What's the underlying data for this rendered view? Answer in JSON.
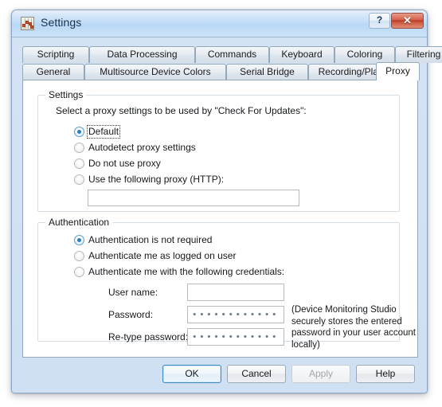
{
  "window": {
    "title": "Settings",
    "app_icon": "chart-grid-icon",
    "help_button": "?",
    "close_button": "✕"
  },
  "tabs": {
    "row1": [
      {
        "label": "Scripting",
        "active": false
      },
      {
        "label": "Data Processing",
        "active": false
      },
      {
        "label": "Commands",
        "active": false
      },
      {
        "label": "Keyboard",
        "active": false
      },
      {
        "label": "Coloring",
        "active": false
      },
      {
        "label": "Filtering",
        "active": false
      }
    ],
    "row2": [
      {
        "label": "General",
        "active": false
      },
      {
        "label": "Multisource Device Colors",
        "active": false
      },
      {
        "label": "Serial Bridge",
        "active": false
      },
      {
        "label": "Recording/Playback",
        "active": false
      },
      {
        "label": "Proxy",
        "active": true
      }
    ]
  },
  "settings_group": {
    "legend": "Settings",
    "description": "Select a proxy settings to be used by \"Check For Updates\":",
    "options": [
      {
        "label": "Default",
        "checked": true,
        "focused": true
      },
      {
        "label": "Autodetect proxy settings",
        "checked": false,
        "focused": false
      },
      {
        "label": "Do not use proxy",
        "checked": false,
        "focused": false
      },
      {
        "label": "Use the following proxy (HTTP):",
        "checked": false,
        "focused": false
      }
    ],
    "proxy_input": {
      "value": "",
      "placeholder": ""
    }
  },
  "authentication_group": {
    "legend": "Authentication",
    "options": [
      {
        "label": "Authentication is not required",
        "checked": true
      },
      {
        "label": "Authenticate me as logged on user",
        "checked": false
      },
      {
        "label": "Authenticate me with the following credentials:",
        "checked": false
      }
    ],
    "fields": {
      "username_label": "User name:",
      "username_value": "",
      "password_label": "Password:",
      "password_masked": "••••••••••••",
      "retype_label": "Re-type password:",
      "retype_masked": "••••••••••••"
    },
    "note": "(Device Monitoring Studio securely stores the entered password in your user account locally)"
  },
  "footer": {
    "ok": "OK",
    "cancel": "Cancel",
    "apply": "Apply",
    "help": "Help"
  },
  "colors": {
    "accent": "#2a7fc0",
    "titlebar": "#bedcf6",
    "close_button": "#b93a22",
    "panel": "#ffffff"
  }
}
